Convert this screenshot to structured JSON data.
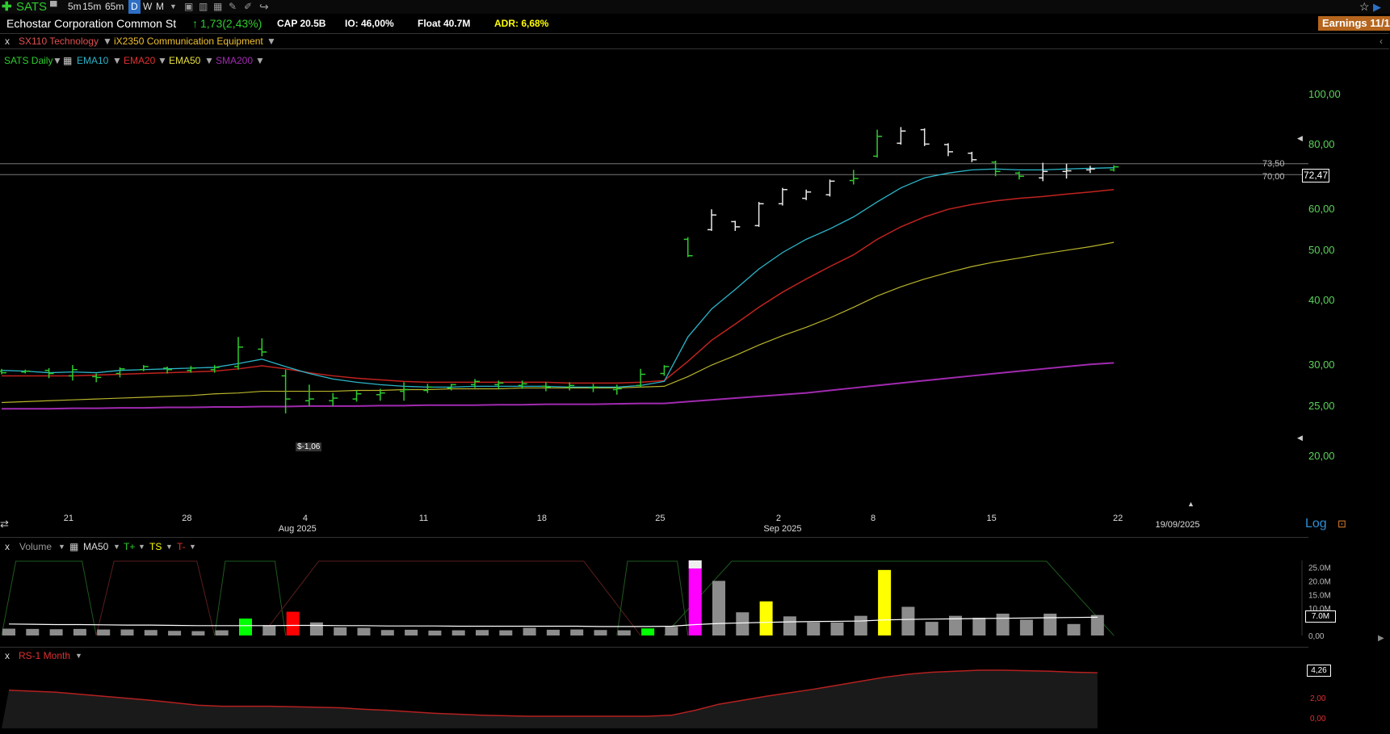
{
  "toolbar": {
    "symbol": "SATS",
    "timeframes": [
      "5m",
      "15m",
      "65m",
      "D",
      "W",
      "M"
    ],
    "active_timeframe": "D"
  },
  "info": {
    "company": "Echostar Corporation Common St",
    "change": "1,73(2,43%)",
    "cap": "CAP 20.5B",
    "io": "IO: 46,00%",
    "float": "Float 40.7M",
    "adr": "ADR: 6,68%",
    "earnings": "Earnings 11/1"
  },
  "sector": {
    "close": "x",
    "sector": "SX110 Technology",
    "industry": "iX2350 Communication Equipment"
  },
  "legend": {
    "close": "x",
    "series": "SATS Daily",
    "ema10": "EMA10",
    "ema20": "EMA20",
    "ema50": "EMA50",
    "sma200": "SMA200"
  },
  "colors": {
    "up": "#2ecc2e",
    "down": "#e8e8e8",
    "ema10": "#2bb5c8",
    "ema20": "#c0231f",
    "ema50": "#b8b42b",
    "sma200": "#a12ab0",
    "axis": "#5bd35b",
    "volume_gray": "#8c8c8c",
    "volume_magenta": "#ff00ff",
    "volume_yellow": "#ffff00",
    "volume_green": "#00ff00",
    "volume_red": "#ff0000",
    "rs_line": "#b52020"
  },
  "price_axis": {
    "ticks": [
      "100,00",
      "80,00",
      "60,00",
      "50,00",
      "40,00",
      "30,00",
      "25,00",
      "20,00"
    ],
    "tick_values": [
      100,
      80,
      60,
      50,
      40,
      30,
      25,
      20
    ],
    "scale": "log",
    "current_price": "72,47",
    "levels": [
      {
        "label": "73,50",
        "value": 73.5
      },
      {
        "label": "70,00",
        "value": 70.0
      }
    ],
    "log_label": "Log",
    "dividend_label": "$-1,06"
  },
  "x_axis": {
    "days": [
      "21",
      "28",
      "4",
      "11",
      "18",
      "25",
      "2",
      "8",
      "15",
      "22"
    ],
    "months": [
      "Aug 2025",
      "Sep 2025"
    ],
    "last_date": "19/09/2025"
  },
  "chart_data": {
    "type": "ohlc",
    "ylim": [
      20,
      100
    ],
    "scale": "log",
    "bars": [
      {
        "h": 29.5,
        "l": 28.8,
        "o": 29.2,
        "c": 29.0,
        "up": true
      },
      {
        "h": 29.4,
        "l": 28.9,
        "o": 29.1,
        "c": 29.2,
        "up": true
      },
      {
        "h": 29.6,
        "l": 28.3,
        "o": 29.3,
        "c": 28.9,
        "up": true
      },
      {
        "h": 30.0,
        "l": 28.0,
        "o": 28.6,
        "c": 29.4,
        "up": true
      },
      {
        "h": 28.9,
        "l": 27.8,
        "o": 28.5,
        "c": 28.4,
        "up": true
      },
      {
        "h": 29.7,
        "l": 28.4,
        "o": 28.9,
        "c": 29.5,
        "up": true
      },
      {
        "h": 30.0,
        "l": 29.2,
        "o": 29.4,
        "c": 29.8,
        "up": true
      },
      {
        "h": 29.8,
        "l": 28.9,
        "o": 29.6,
        "c": 29.4,
        "up": true
      },
      {
        "h": 29.9,
        "l": 29.0,
        "o": 29.3,
        "c": 29.6,
        "up": true
      },
      {
        "h": 30.0,
        "l": 29.0,
        "o": 29.4,
        "c": 29.7,
        "up": true
      },
      {
        "h": 34.0,
        "l": 29.4,
        "o": 29.8,
        "c": 32.5,
        "up": true
      },
      {
        "h": 33.8,
        "l": 31.2,
        "o": 32.2,
        "c": 31.8,
        "up": true
      },
      {
        "h": 29.4,
        "l": 24.2,
        "o": 28.6,
        "c": 25.8,
        "up": true
      },
      {
        "h": 27.5,
        "l": 25.0,
        "o": 25.6,
        "c": 25.8,
        "up": true
      },
      {
        "h": 26.5,
        "l": 25.0,
        "o": 25.6,
        "c": 25.9,
        "up": true
      },
      {
        "h": 26.8,
        "l": 25.5,
        "o": 25.8,
        "c": 26.4,
        "up": true
      },
      {
        "h": 27.0,
        "l": 25.6,
        "o": 26.3,
        "c": 26.5,
        "up": true
      },
      {
        "h": 27.8,
        "l": 25.6,
        "o": 26.7,
        "c": 26.9,
        "up": true
      },
      {
        "h": 27.6,
        "l": 26.5,
        "o": 26.8,
        "c": 27.2,
        "up": true
      },
      {
        "h": 27.6,
        "l": 26.8,
        "o": 27.1,
        "c": 27.5,
        "up": true
      },
      {
        "h": 28.2,
        "l": 27.1,
        "o": 27.5,
        "c": 27.9,
        "up": true
      },
      {
        "h": 28.0,
        "l": 27.0,
        "o": 27.5,
        "c": 27.7,
        "up": true
      },
      {
        "h": 28.0,
        "l": 27.0,
        "o": 27.4,
        "c": 27.6,
        "up": true
      },
      {
        "h": 27.8,
        "l": 26.7,
        "o": 27.3,
        "c": 27.2,
        "up": true
      },
      {
        "h": 27.8,
        "l": 26.8,
        "o": 27.2,
        "c": 27.4,
        "up": true
      },
      {
        "h": 27.6,
        "l": 26.6,
        "o": 27.1,
        "c": 27.2,
        "up": true
      },
      {
        "h": 27.5,
        "l": 26.3,
        "o": 26.9,
        "c": 27.0,
        "up": true
      },
      {
        "h": 29.5,
        "l": 27.2,
        "o": 27.4,
        "c": 28.8,
        "up": true
      },
      {
        "h": 30.0,
        "l": 28.6,
        "o": 28.9,
        "c": 29.8,
        "up": true
      },
      {
        "h": 53.0,
        "l": 48.5,
        "o": 52.5,
        "c": 48.8,
        "up": true
      },
      {
        "h": 60.0,
        "l": 54.5,
        "o": 54.8,
        "c": 58.5,
        "up": false
      },
      {
        "h": 57.0,
        "l": 54.5,
        "o": 56.8,
        "c": 55.5,
        "up": false
      },
      {
        "h": 62.0,
        "l": 55.5,
        "o": 55.8,
        "c": 61.5,
        "up": false
      },
      {
        "h": 66.0,
        "l": 61.0,
        "o": 61.5,
        "c": 65.5,
        "up": false
      },
      {
        "h": 65.5,
        "l": 62.5,
        "o": 63.0,
        "c": 64.8,
        "up": false
      },
      {
        "h": 68.5,
        "l": 63.5,
        "o": 64.0,
        "c": 68.0,
        "up": false
      },
      {
        "h": 71.5,
        "l": 67.0,
        "o": 68.2,
        "c": 68.8,
        "up": true
      },
      {
        "h": 85.5,
        "l": 75.5,
        "o": 76.0,
        "c": 83.0,
        "up": true
      },
      {
        "h": 86.5,
        "l": 80.0,
        "o": 80.5,
        "c": 85.0,
        "up": false
      },
      {
        "h": 86.0,
        "l": 79.5,
        "o": 85.5,
        "c": 80.2,
        "up": false
      },
      {
        "h": 80.5,
        "l": 76.0,
        "o": 80.0,
        "c": 77.5,
        "up": false
      },
      {
        "h": 77.5,
        "l": 74.0,
        "o": 77.0,
        "c": 74.8,
        "up": false
      },
      {
        "h": 74.5,
        "l": 69.5,
        "o": 74.0,
        "c": 71.0,
        "up": true
      },
      {
        "h": 71.0,
        "l": 68.5,
        "o": 70.5,
        "c": 69.5,
        "up": true
      },
      {
        "h": 73.8,
        "l": 68.0,
        "o": 69.0,
        "c": 71.0,
        "up": false
      },
      {
        "h": 73.5,
        "l": 68.8,
        "o": 71.0,
        "c": 71.2,
        "up": false
      },
      {
        "h": 72.8,
        "l": 70.5,
        "o": 71.5,
        "c": 71.8,
        "up": false
      },
      {
        "h": 73.0,
        "l": 71.0,
        "o": 71.5,
        "c": 72.47,
        "up": true
      }
    ],
    "ema10": [
      29.3,
      29.2,
      29.0,
      29.1,
      29.0,
      29.3,
      29.4,
      29.5,
      29.6,
      29.7,
      30.2,
      30.8,
      29.8,
      28.9,
      28.2,
      27.8,
      27.5,
      27.3,
      27.2,
      27.2,
      27.3,
      27.3,
      27.3,
      27.3,
      27.2,
      27.2,
      27.2,
      27.4,
      27.9,
      34,
      38.5,
      42,
      46,
      49.5,
      52.5,
      55,
      58,
      62,
      66,
      69,
      70.5,
      71.5,
      71.8,
      71.5,
      71.5,
      71.8,
      72.0,
      72.2
    ],
    "ema20": [
      28.6,
      28.6,
      28.6,
      28.6,
      28.7,
      28.8,
      28.9,
      29.0,
      29.1,
      29.2,
      29.5,
      29.9,
      29.5,
      29.0,
      28.6,
      28.3,
      28.1,
      27.9,
      27.8,
      27.8,
      27.8,
      27.8,
      27.8,
      27.8,
      27.7,
      27.7,
      27.7,
      27.8,
      28.0,
      30.5,
      33.5,
      36,
      38.8,
      41.5,
      44,
      46.5,
      49,
      52.5,
      55.5,
      58,
      60,
      61.3,
      62.3,
      63.0,
      63.5,
      64.2,
      64.8,
      65.5
    ],
    "ema50": [
      25.4,
      25.5,
      25.6,
      25.7,
      25.8,
      25.9,
      26.0,
      26.1,
      26.2,
      26.4,
      26.5,
      26.7,
      26.7,
      26.7,
      26.7,
      26.8,
      26.8,
      26.9,
      26.9,
      27.0,
      27.0,
      27.0,
      27.1,
      27.1,
      27.1,
      27.1,
      27.1,
      27.2,
      27.3,
      28.5,
      30,
      31.3,
      32.8,
      34.2,
      35.5,
      37,
      38.8,
      40.8,
      42.5,
      44,
      45.3,
      46.5,
      47.5,
      48.3,
      49.2,
      50.0,
      50.8,
      51.8
    ],
    "sma200": [
      24.7,
      24.7,
      24.7,
      24.75,
      24.75,
      24.8,
      24.8,
      24.85,
      24.85,
      24.9,
      24.9,
      24.95,
      24.95,
      25.0,
      25.0,
      25.0,
      25.05,
      25.05,
      25.1,
      25.1,
      25.1,
      25.15,
      25.15,
      25.2,
      25.2,
      25.2,
      25.25,
      25.3,
      25.3,
      25.5,
      25.7,
      25.9,
      26.1,
      26.3,
      26.5,
      26.8,
      27.1,
      27.4,
      27.7,
      28.0,
      28.3,
      28.6,
      28.9,
      29.2,
      29.5,
      29.8,
      30.1,
      30.3
    ]
  },
  "volume_panel": {
    "close": "x",
    "label": "Volume",
    "ma_label": "MA50",
    "tplus": "T+",
    "ts": "TS",
    "tminus": "T-",
    "ticks": [
      "25.0M",
      "20.0M",
      "15.0M",
      "10.0M",
      "7.0M",
      "0,00"
    ],
    "tick_values": [
      25,
      20,
      15,
      10,
      7,
      0
    ],
    "current": "7.0M",
    "values": [
      2.5,
      2.4,
      2.3,
      2.4,
      2.2,
      2.2,
      2.0,
      1.7,
      1.6,
      1.9,
      6.2,
      3.8,
      8.7,
      4.8,
      3.0,
      2.8,
      2.0,
      2.1,
      1.8,
      1.9,
      2.0,
      1.9,
      2.8,
      2.1,
      2.2,
      2.0,
      1.9,
      2.6,
      3.2,
      27.5,
      20.0,
      8.5,
      12.5,
      7.0,
      4.8,
      4.8,
      7.2,
      24.0,
      10.5,
      5.0,
      7.2,
      6.5,
      8.0,
      5.8,
      8.0,
      4.2,
      7.5
    ],
    "colors": [
      "gray",
      "gray",
      "gray",
      "gray",
      "gray",
      "gray",
      "gray",
      "gray",
      "gray",
      "gray",
      "green",
      "gray",
      "red",
      "gray",
      "gray",
      "gray",
      "gray",
      "gray",
      "gray",
      "gray",
      "gray",
      "gray",
      "gray",
      "gray",
      "gray",
      "gray",
      "gray",
      "green",
      "gray",
      "magenta",
      "gray",
      "gray",
      "yellow",
      "gray",
      "gray",
      "gray",
      "gray",
      "yellow",
      "gray",
      "gray",
      "gray",
      "gray",
      "gray",
      "gray",
      "gray",
      "gray",
      "gray"
    ],
    "ma50": [
      4.2,
      4.1,
      4.0,
      4.0,
      3.9,
      3.8,
      3.8,
      3.7,
      3.6,
      3.6,
      3.6,
      3.6,
      3.7,
      3.7,
      3.6,
      3.6,
      3.5,
      3.5,
      3.5,
      3.4,
      3.4,
      3.4,
      3.4,
      3.4,
      3.4,
      3.3,
      3.3,
      3.3,
      3.4,
      4.0,
      4.4,
      4.6,
      4.8,
      5.0,
      5.1,
      5.2,
      5.3,
      5.7,
      5.9,
      6.0,
      6.1,
      6.2,
      6.3,
      6.4,
      6.5,
      6.6,
      6.7
    ]
  },
  "rs_panel": {
    "close": "x",
    "label": "RS-1 Month",
    "ticks": [
      "4,26",
      "2,00",
      "0,00"
    ],
    "tick_values": [
      4.26,
      2.0,
      0.0
    ],
    "values": [
      0.6,
      0.58,
      0.56,
      0.52,
      0.48,
      0.44,
      0.4,
      0.35,
      0.3,
      0.28,
      0.28,
      0.28,
      0.27,
      0.26,
      0.25,
      0.22,
      0.2,
      0.17,
      0.14,
      0.12,
      0.1,
      0.09,
      0.08,
      0.08,
      0.08,
      0.08,
      0.08,
      0.08,
      0.1,
      0.2,
      0.32,
      0.4,
      0.48,
      0.55,
      0.62,
      0.7,
      0.78,
      0.86,
      0.92,
      0.96,
      0.98,
      1.0,
      1.0,
      0.99,
      0.98,
      0.96,
      0.95
    ]
  }
}
